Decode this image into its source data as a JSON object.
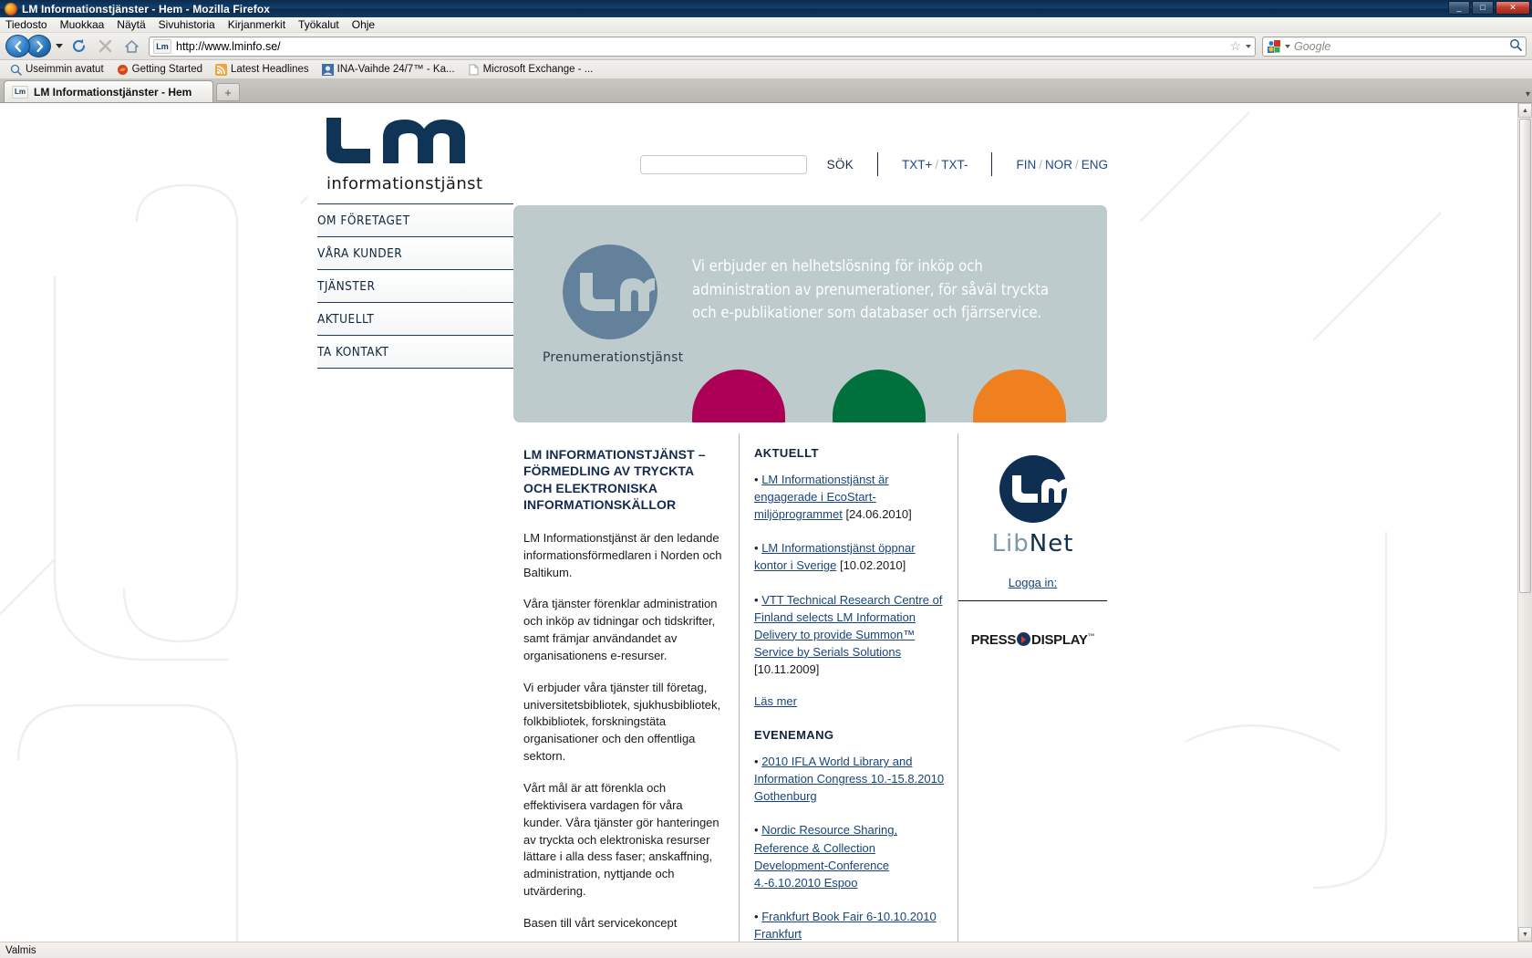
{
  "window": {
    "title": "LM Informationstjänster - Hem - Mozilla Firefox",
    "minimize": "_",
    "maximize": "□",
    "close": "✕"
  },
  "menubar": [
    "Tiedosto",
    "Muokkaa",
    "Näytä",
    "Sivuhistoria",
    "Kirjanmerkit",
    "Työkalut",
    "Ohje"
  ],
  "toolbar": {
    "back_icon": "back-arrow",
    "forward_icon": "forward-arrow",
    "reload_icon": "reload-icon",
    "stop_icon": "stop-icon",
    "home_icon": "home-icon",
    "url": "http://www.lminfo.se/",
    "url_favicon_label": "Lm",
    "bookmark_star_icon": "star-icon",
    "search_engine": "Google",
    "search_placeholder": "Google",
    "search_icon": "magnifier-icon"
  },
  "bookmarks": [
    {
      "label": "Useimmin avatut",
      "icon": "most-visited-icon"
    },
    {
      "label": "Getting Started",
      "icon": "firefox-icon"
    },
    {
      "label": "Latest Headlines",
      "icon": "rss-icon"
    },
    {
      "label": "INA-Vaihde 24/7™ - Ka...",
      "icon": "page-icon"
    },
    {
      "label": "Microsoft Exchange - ...",
      "icon": "blank-page-icon"
    }
  ],
  "tabs": {
    "active": "LM Informationstjänster - Hem",
    "favicon_label": "Lm",
    "new_tab_label": "+"
  },
  "statusbar": {
    "text": "Valmis"
  },
  "site": {
    "logo": {
      "mark": "Lm",
      "subtitle": "informationstjänst"
    },
    "header": {
      "search_value": "",
      "search_placeholder": "",
      "search_button": "SÖK",
      "textsize": {
        "plus": "TXT+",
        "sep": "/",
        "minus": "TXT-"
      },
      "languages": [
        "FIN",
        "NOR",
        "ENG"
      ],
      "lang_sep": "/"
    },
    "nav": [
      {
        "label": "OM FÖRETAGET"
      },
      {
        "label": "VÅRA KUNDER"
      },
      {
        "label": "TJÄNSTER"
      },
      {
        "label": "AKTUELLT"
      },
      {
        "label": "TA KONTAKT"
      }
    ],
    "hero": {
      "logo_caption": "Prenumerationstjänst",
      "text": "Vi erbjuder en helhetslösning för inköp och administration av prenumerationer, för såväl tryckta och e-publikationer som databaser och fjärrservice.",
      "bg_color": "#bdcbcd",
      "dots": [
        "#ab0055",
        "#00703c",
        "#ef7f1f"
      ]
    },
    "article": {
      "heading": "LM INFORMATIONSTJÄNST – FÖRMEDLING AV TRYCKTA OCH ELEKTRONISKA INFORMATIONSKÄLLOR",
      "paragraphs": [
        "LM Informationstjänst är den ledande informationsförmedlaren i Norden och Baltikum.",
        "Våra tjänster förenklar administration och inköp av tidningar och tidskrifter, samt främjar användandet av organisationens e-resurser.",
        "Vi erbjuder våra tjänster till företag, universitetsbibliotek, sjukhusbibliotek, folkbibliotek, forskningstäta organisationer och den offentliga sektorn.",
        "Vårt mål är att förenkla och effektivisera vardagen för våra kunder. Våra tjänster gör hanteringen av tryckta och elektroniska resurser lättare i alla dess faser; anskaffning, administration, nyttjande och utvärdering.",
        "Basen till vårt servicekoncept"
      ]
    },
    "news": {
      "heading": "AKTUELLT",
      "items": [
        {
          "bullet": "•",
          "link": "LM Informationstjänst är engagerade i EcoStart-miljöprogrammet",
          "date": "[24.06.2010]"
        },
        {
          "bullet": "•",
          "link": "LM Informationstjänst öppnar kontor i Sverige",
          "date": "[10.02.2010]"
        },
        {
          "bullet": "•",
          "link": "VTT Technical Research Centre of Finland selects LM Information Delivery to provide Summon™ Service by Serials Solutions",
          "date": "[10.11.2009]"
        }
      ],
      "read_more": "Läs mer",
      "events_heading": "EVENEMANG",
      "events": [
        {
          "bullet": "•",
          "link": "2010 IFLA World Library and Information Congress 10.-15.8.2010 Gothenburg",
          "date": ""
        },
        {
          "bullet": "•",
          "link": "Nordic Resource Sharing, Reference & Collection Development-Conference 4.-6.10.2010 Espoo",
          "date": ""
        },
        {
          "bullet": "•",
          "link": "Frankfurt Book Fair 6-10.10.2010 Frankfurt",
          "date": ""
        }
      ]
    },
    "sidebar": {
      "libnet": {
        "lib": "Lib",
        "net": "Net",
        "mark": "Lm"
      },
      "login_label": "Logga in:",
      "pressdisplay": {
        "press": "PRESS",
        "display": "DISPLAY",
        "tm": "™"
      }
    }
  }
}
